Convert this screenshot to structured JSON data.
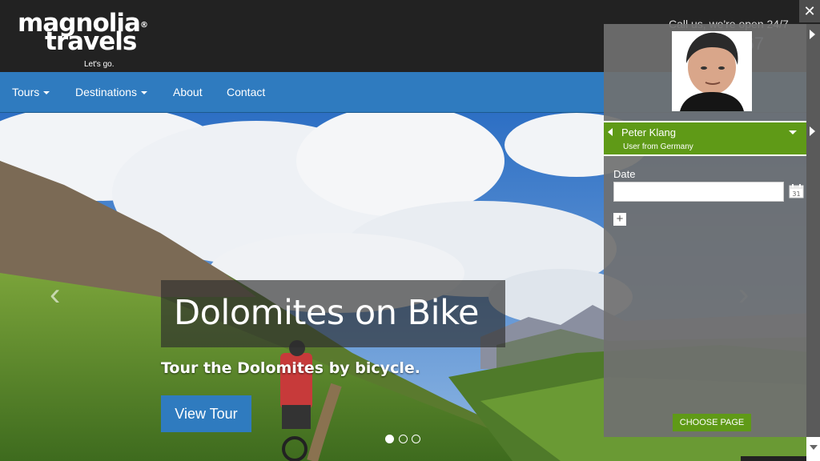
{
  "header": {
    "logo_line1": "magnolia",
    "logo_line2": "travels",
    "logo_reg": "®",
    "tagline": "Let's go.",
    "call_us": "Call us, we're open 24/7",
    "phone_partial": "4567"
  },
  "nav": {
    "items": [
      {
        "label": "Tours",
        "dropdown": true
      },
      {
        "label": "Destinations",
        "dropdown": true
      },
      {
        "label": "About",
        "dropdown": false
      },
      {
        "label": "Contact",
        "dropdown": false
      }
    ]
  },
  "hero": {
    "title": "Dolomites on Bike",
    "subtitle": "Tour the Dolomites by bicycle.",
    "button_label": "View Tour",
    "prev_glyph": "‹",
    "next_glyph": "›",
    "slides_count": 3,
    "active_slide": 1
  },
  "panel": {
    "persona_name": "Peter Klang",
    "persona_desc": "User from Germany",
    "date_label": "Date",
    "date_value": "",
    "add_glyph": "+",
    "choose_page_label": "CHOOSE PAGE",
    "close_glyph": "✕"
  },
  "colors": {
    "brand_blue": "#2f7bbf",
    "persona_green": "#5f9a17",
    "header_dark": "#222222"
  }
}
